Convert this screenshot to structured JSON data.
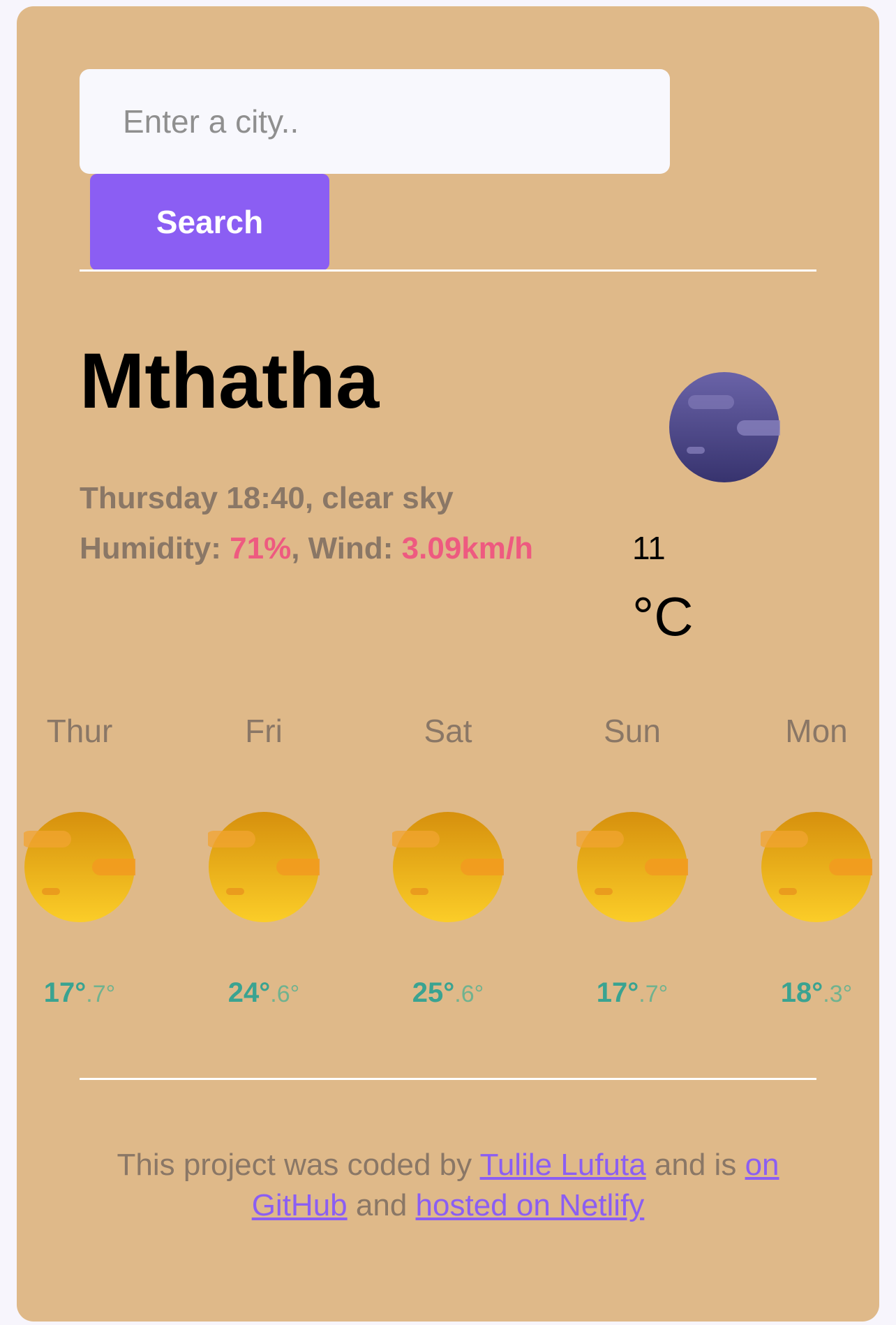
{
  "search": {
    "placeholder": "Enter a city..",
    "button_label": "Search"
  },
  "current": {
    "city": "Mthatha",
    "day_time": "Thursday 18:40",
    "description": "clear sky",
    "humidity_label": "Humidity:",
    "humidity_value": "71%",
    "wind_label": "Wind:",
    "wind_value": "3.09km/h",
    "temperature": "11",
    "unit": "°C",
    "icon": "clear-night-icon"
  },
  "forecast": [
    {
      "day": "Thur",
      "max": "17°",
      "min": ".7°",
      "icon": "sun-icon"
    },
    {
      "day": "Fri",
      "max": "24°",
      "min": ".6°",
      "icon": "sun-icon"
    },
    {
      "day": "Sat",
      "max": "25°",
      "min": ".6°",
      "icon": "sun-icon"
    },
    {
      "day": "Sun",
      "max": "17°",
      "min": ".7°",
      "icon": "sun-icon"
    },
    {
      "day": "Mon",
      "max": "18°",
      "min": ".3°",
      "icon": "sun-icon"
    }
  ],
  "footer": {
    "text1": "This project was coded by",
    "author_link": "Tulile Lufuta",
    "text2": "and is",
    "github_link": "on GitHub",
    "text3": "and",
    "netlify_link": "hosted on Netlify"
  },
  "colors": {
    "card": "#dfb989",
    "button": "#8b5ef3",
    "accent": "#ee5a80",
    "forecast_max": "#3aa391",
    "forecast_min": "#70b28f"
  }
}
